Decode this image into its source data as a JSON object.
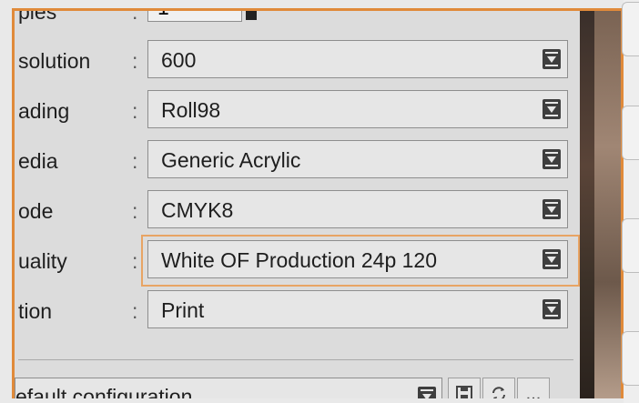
{
  "form": {
    "copies": {
      "label": "pies",
      "value": "1"
    },
    "rows": [
      {
        "label": "solution",
        "value": "600"
      },
      {
        "label": "ading",
        "value": "Roll98"
      },
      {
        "label": "edia",
        "value": "Generic Acrylic"
      },
      {
        "label": "ode",
        "value": "CMYK8"
      },
      {
        "label": "uality",
        "value": "White OF Production 24p 120"
      },
      {
        "label": "tion",
        "value": "Print"
      }
    ],
    "colon": ":",
    "configuration": "efault configuration",
    "config_buttons": {
      "save_icon": "save-icon",
      "refresh_icon": "refresh-icon",
      "more_label": "..."
    }
  },
  "colors": {
    "accent_frame": "#e08a3a",
    "highlight": "#e8a464"
  }
}
